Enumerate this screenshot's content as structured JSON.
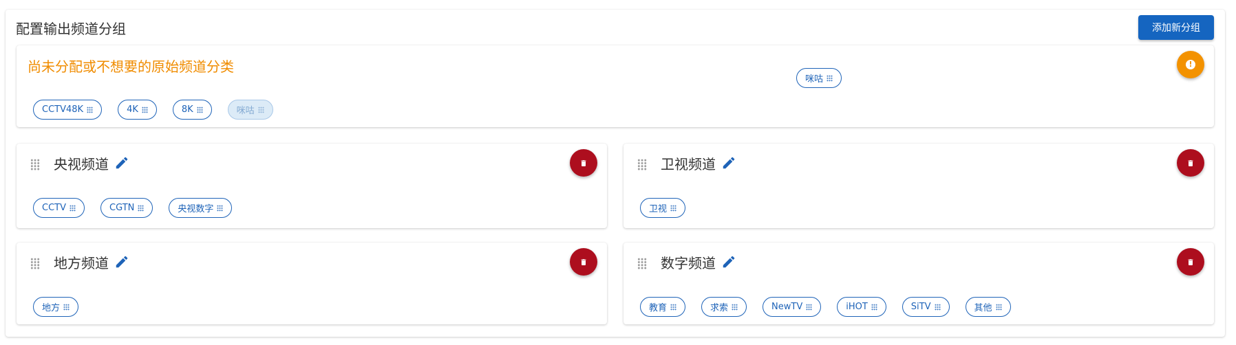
{
  "page": {
    "title": "配置输出频道分组",
    "add_button": "添加新分组"
  },
  "unassigned": {
    "title": "尚未分配或不想要的原始频道分类",
    "icon": "alert-circle-icon",
    "chips": [
      {
        "label": "CCTV48K",
        "state": "normal"
      },
      {
        "label": "4K",
        "state": "normal"
      },
      {
        "label": "8K",
        "state": "normal"
      },
      {
        "label": "咪咕",
        "state": "ghost"
      }
    ],
    "dragging_chip": "咪咕"
  },
  "groups": [
    {
      "name": "央视频道",
      "chips": [
        "CCTV",
        "CGTN",
        "央视数字"
      ]
    },
    {
      "name": "卫视频道",
      "chips": [
        "卫视"
      ]
    },
    {
      "name": "地方频道",
      "chips": [
        "地方"
      ]
    },
    {
      "name": "数字频道",
      "chips": [
        "教育",
        "求索",
        "NewTV",
        "iHOT",
        "SiTV",
        "其他"
      ]
    }
  ],
  "colors": {
    "primary": "#1565c0",
    "warning": "#f39200",
    "danger": "#ad0e1e",
    "chip": "#1e63b8"
  }
}
